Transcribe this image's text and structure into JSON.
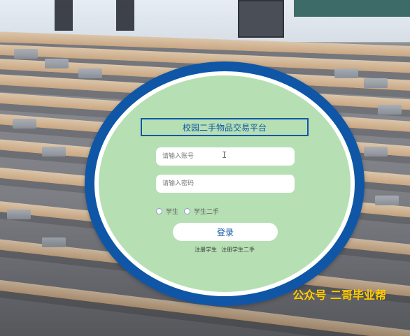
{
  "login": {
    "title": "校园二手物品交易平台",
    "account_placeholder": "请输入账号",
    "password_placeholder": "请输入密码",
    "role_options": [
      "学生",
      "学生二手"
    ],
    "login_button": "登录",
    "register_links": [
      "注册学生",
      "注册学生二手"
    ]
  },
  "watermark": {
    "text": "公众号 二哥毕业帮"
  },
  "colors": {
    "ring_blue": "#0f57a6",
    "panel_green": "#b6e0b3",
    "watermark_yellow": "#ffcc00"
  },
  "icons": {
    "text_cursor": "text-cursor-icon"
  }
}
